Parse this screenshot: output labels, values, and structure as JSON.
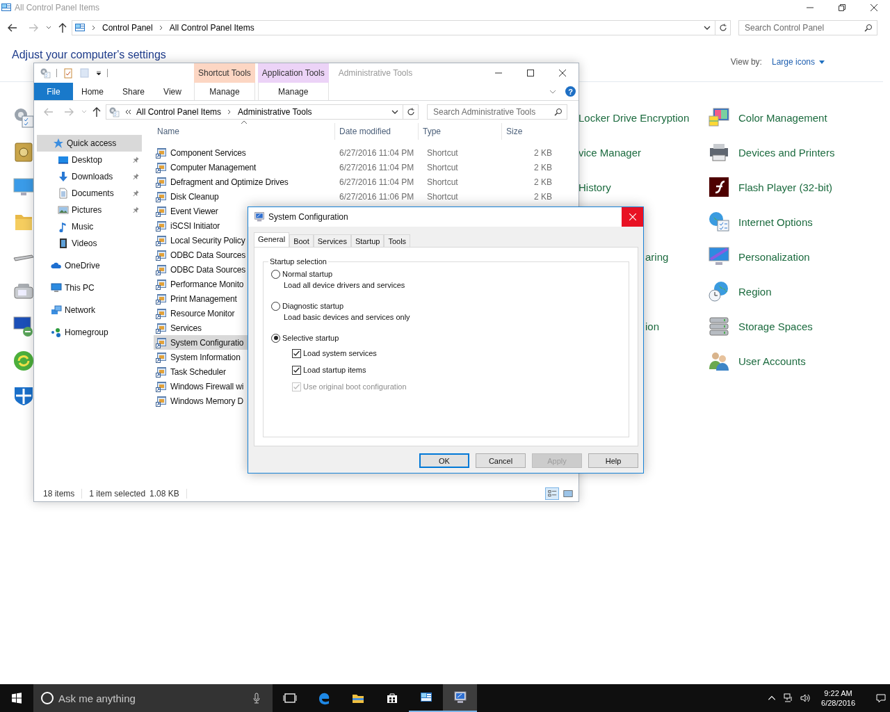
{
  "control_panel": {
    "title": "All Control Panel Items",
    "breadcrumb": [
      "Control Panel",
      "All Control Panel Items"
    ],
    "search": {
      "placeholder": "Search Control Panel"
    },
    "heading": "Adjust your computer's settings",
    "view_by_label": "View by:",
    "view_by_value": "Large icons",
    "items_column_2": [
      "Locker Drive Encryption",
      "vice Manager",
      "History",
      "aring",
      "ion"
    ],
    "items_column_3": [
      "Color Management",
      "Devices and Printers",
      "Flash Player (32-bit)",
      "Internet Options",
      "Personalization",
      "Region",
      "Storage Spaces",
      "User Accounts"
    ]
  },
  "explorer": {
    "title": "Administrative Tools",
    "context_tabs": [
      {
        "label": "Shortcut Tools",
        "tab": "Manage",
        "color": "#fcd6c3"
      },
      {
        "label": "Application Tools",
        "tab": "Manage",
        "color": "#ecd3f7"
      }
    ],
    "tabs": [
      {
        "label": "File",
        "kind": "file"
      },
      {
        "label": "Home",
        "kind": "tab"
      },
      {
        "label": "Share",
        "kind": "tab"
      },
      {
        "label": "View",
        "kind": "tab"
      }
    ],
    "help_glyph": "?",
    "breadcrumb": [
      "All Control Panel Items",
      "Administrative Tools"
    ],
    "search": {
      "placeholder": "Search Administrative Tools"
    },
    "nav": [
      {
        "label": "Quick access",
        "selected": true,
        "children": [
          {
            "label": "Desktop",
            "pinned": true
          },
          {
            "label": "Downloads",
            "pinned": true
          },
          {
            "label": "Documents",
            "pinned": true
          },
          {
            "label": "Pictures",
            "pinned": true
          },
          {
            "label": "Music",
            "pinned": false
          },
          {
            "label": "Videos",
            "pinned": false
          }
        ]
      },
      {
        "label": "OneDrive",
        "selected": false
      },
      {
        "label": "This PC",
        "selected": false
      },
      {
        "label": "Network",
        "selected": false
      },
      {
        "label": "Homegroup",
        "selected": false
      }
    ],
    "columns": [
      "Name",
      "Date modified",
      "Type",
      "Size"
    ],
    "rows": [
      {
        "name": "Component Services",
        "date": "6/27/2016 11:04 PM",
        "type": "Shortcut",
        "size": "2 KB",
        "selected": false
      },
      {
        "name": "Computer Management",
        "date": "6/27/2016 11:04 PM",
        "type": "Shortcut",
        "size": "2 KB",
        "selected": false
      },
      {
        "name": "Defragment and Optimize Drives",
        "date": "6/27/2016 11:04 PM",
        "type": "Shortcut",
        "size": "2 KB",
        "selected": false
      },
      {
        "name": "Disk Cleanup",
        "date": "6/27/2016 11:06 PM",
        "type": "Shortcut",
        "size": "2 KB",
        "selected": false
      },
      {
        "name": "Event Viewer",
        "selected": false
      },
      {
        "name": "iSCSI Initiator",
        "selected": false
      },
      {
        "name": "Local Security Policy",
        "selected": false
      },
      {
        "name": "ODBC Data Sources",
        "selected": false
      },
      {
        "name": "ODBC Data Sources",
        "selected": false
      },
      {
        "name": "Performance Monito",
        "selected": false
      },
      {
        "name": "Print Management",
        "selected": false
      },
      {
        "name": "Resource Monitor",
        "selected": false
      },
      {
        "name": "Services",
        "selected": false
      },
      {
        "name": "System Configuratio",
        "selected": true
      },
      {
        "name": "System Information",
        "selected": false
      },
      {
        "name": "Task Scheduler",
        "selected": false
      },
      {
        "name": "Windows Firewall wi",
        "selected": false
      },
      {
        "name": "Windows Memory D",
        "selected": false
      }
    ],
    "status": {
      "count": "18 items",
      "selection": "1 item selected",
      "size": "1.08 KB"
    },
    "views": [
      {
        "selected": true
      },
      {
        "selected": false
      }
    ]
  },
  "dialog": {
    "title": "System Configuration",
    "tabs": [
      {
        "label": "General",
        "selected": true
      },
      {
        "label": "Boot",
        "selected": false
      },
      {
        "label": "Services",
        "selected": false
      },
      {
        "label": "Startup",
        "selected": false
      },
      {
        "label": "Tools",
        "selected": false
      }
    ],
    "group_title": "Startup selection",
    "options": [
      {
        "kind": "radio",
        "label": "Normal startup",
        "description": "Load all device drivers and services",
        "selected": false
      },
      {
        "kind": "radio",
        "label": "Diagnostic startup",
        "description": "Load basic devices and services only",
        "selected": false
      },
      {
        "kind": "radio",
        "label": "Selective startup",
        "selected": true
      },
      {
        "kind": "checkbox",
        "label": "Load system services",
        "checked": true,
        "disabled": false
      },
      {
        "kind": "checkbox",
        "label": "Load startup items",
        "checked": true,
        "disabled": false
      },
      {
        "kind": "checkbox",
        "label": "Use original boot configuration",
        "checked": true,
        "disabled": true
      }
    ],
    "buttons": [
      {
        "label": "OK",
        "default": true,
        "disabled": false
      },
      {
        "label": "Cancel",
        "default": false,
        "disabled": false
      },
      {
        "label": "Apply",
        "default": false,
        "disabled": true
      },
      {
        "label": "Help",
        "default": false,
        "disabled": false
      }
    ]
  },
  "taskbar": {
    "search": {
      "placeholder": "Ask me anything"
    },
    "apps": [
      {
        "running": false,
        "selected": false
      },
      {
        "running": false,
        "selected": false
      },
      {
        "running": false,
        "selected": false
      },
      {
        "running": false,
        "selected": false
      },
      {
        "running": true,
        "selected": false
      },
      {
        "running": true,
        "selected": true
      }
    ],
    "time": "9:22 AM",
    "date": "6/28/2016"
  }
}
